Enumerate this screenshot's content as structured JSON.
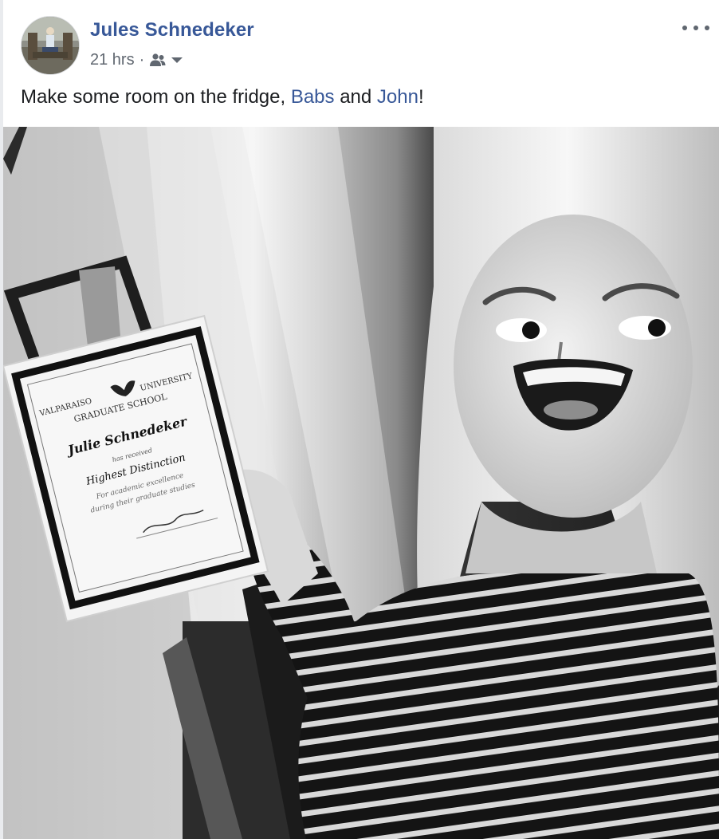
{
  "post": {
    "author": "Jules Schnedeker",
    "time": "21 hrs",
    "separator": "·",
    "audience_icon": "friends-icon",
    "caption": {
      "text_before": "Make some room on the fridge, ",
      "tag1": "Babs",
      "text_middle": " and ",
      "tag2": "John",
      "text_after": "!"
    },
    "menu_icon": "more-options-icon"
  },
  "photo": {
    "certificate": {
      "university_left": "VALPARAISO",
      "university_right": "UNIVERSITY",
      "school": "GRADUATE SCHOOL",
      "name": "Julie Schnedeker",
      "has_received": "has received",
      "award": "Highest Distinction",
      "for_line": "For academic excellence",
      "during_line": "during their graduate studies"
    }
  }
}
